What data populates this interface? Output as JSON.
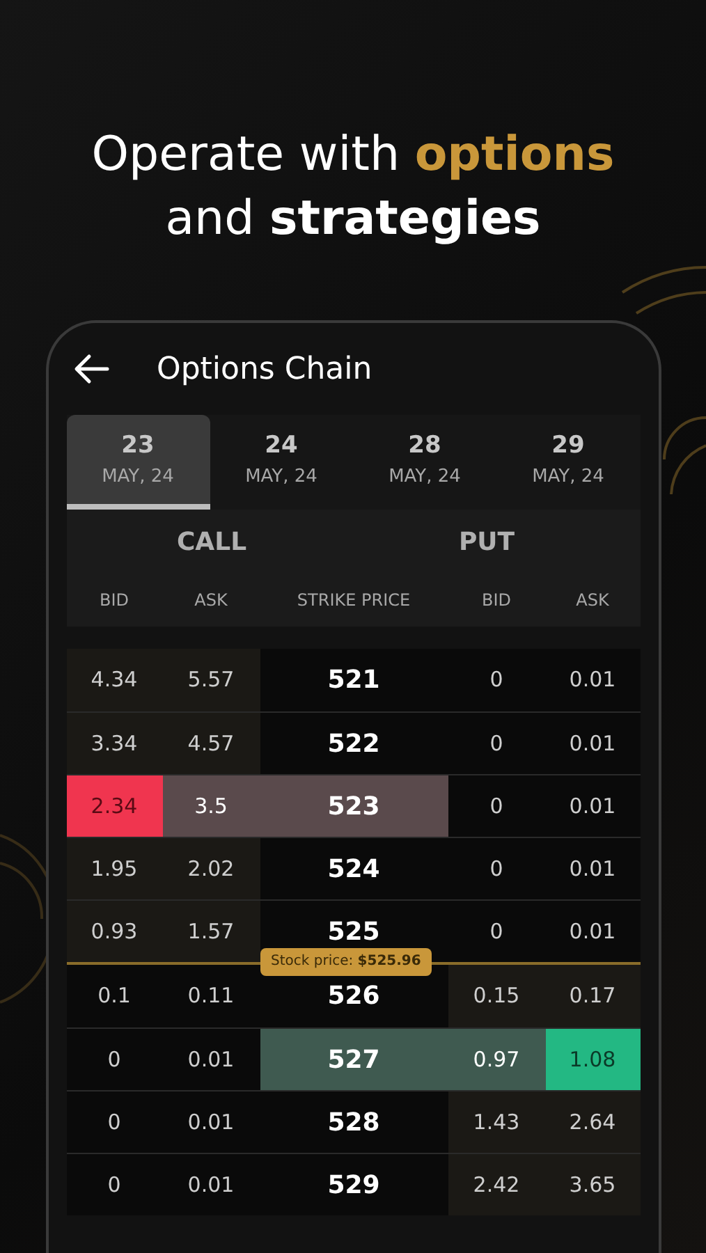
{
  "headline": {
    "line1": [
      {
        "text": "Operate with ",
        "kind": "plain"
      },
      {
        "text": "options",
        "kind": "gold"
      }
    ],
    "line2": [
      {
        "text": "and ",
        "kind": "plain"
      },
      {
        "text": "strategies",
        "kind": "bold"
      }
    ]
  },
  "screen": {
    "title": "Options Chain",
    "dates": [
      {
        "day": "23",
        "month": "MAY, 24",
        "selected": true
      },
      {
        "day": "24",
        "month": "MAY, 24",
        "selected": false
      },
      {
        "day": "28",
        "month": "MAY, 24",
        "selected": false
      },
      {
        "day": "29",
        "month": "MAY, 24",
        "selected": false
      }
    ],
    "sides": [
      "CALL",
      "PUT"
    ],
    "columns": [
      "BID",
      "ASK",
      "STRIKE PRICE",
      "BID",
      "ASK"
    ],
    "rows": [
      {
        "kind": "row",
        "call_bid": "4.34",
        "call_ask": "5.57",
        "strike": "521",
        "put_bid": "0",
        "put_ask": "0.01",
        "call_in_the_money": true,
        "call_bid_selected": false,
        "put_ask_selected": false
      },
      {
        "kind": "row",
        "call_bid": "3.34",
        "call_ask": "4.57",
        "strike": "522",
        "put_bid": "0",
        "put_ask": "0.01",
        "call_in_the_money": true,
        "call_bid_selected": false,
        "put_ask_selected": false
      },
      {
        "kind": "row",
        "call_bid": "2.34",
        "call_ask": "3.5",
        "strike": "523",
        "put_bid": "0",
        "put_ask": "0.01",
        "call_in_the_money": true,
        "call_bid_selected": true,
        "put_ask_selected": false
      },
      {
        "kind": "row",
        "call_bid": "1.95",
        "call_ask": "2.02",
        "strike": "524",
        "put_bid": "0",
        "put_ask": "0.01",
        "call_in_the_money": true,
        "call_bid_selected": false,
        "put_ask_selected": false
      },
      {
        "kind": "row",
        "call_bid": "0.93",
        "call_ask": "1.57",
        "strike": "525",
        "put_bid": "0",
        "put_ask": "0.01",
        "call_in_the_money": true,
        "call_bid_selected": false,
        "put_ask_selected": false
      },
      {
        "kind": "stock_price",
        "text": "Stock price: **$525.96**"
      },
      {
        "kind": "row",
        "call_bid": "0.1",
        "call_ask": "0.11",
        "strike": "526",
        "put_bid": "0.15",
        "put_ask": "0.17",
        "call_in_the_money": false,
        "call_bid_selected": false,
        "put_ask_selected": false
      },
      {
        "kind": "row",
        "call_bid": "0",
        "call_ask": "0.01",
        "strike": "527",
        "put_bid": "0.97",
        "put_ask": "1.08",
        "call_in_the_money": false,
        "call_bid_selected": false,
        "put_ask_selected": true
      },
      {
        "kind": "row",
        "call_bid": "0",
        "call_ask": "0.01",
        "strike": "528",
        "put_bid": "1.43",
        "put_ask": "2.64",
        "call_in_the_money": false,
        "call_bid_selected": false,
        "put_ask_selected": false
      },
      {
        "kind": "row",
        "call_bid": "0",
        "call_ask": "0.01",
        "strike": "529",
        "put_bid": "2.42",
        "put_ask": "3.65",
        "call_in_the_money": false,
        "call_bid_selected": false,
        "put_ask_selected": false
      }
    ]
  }
}
